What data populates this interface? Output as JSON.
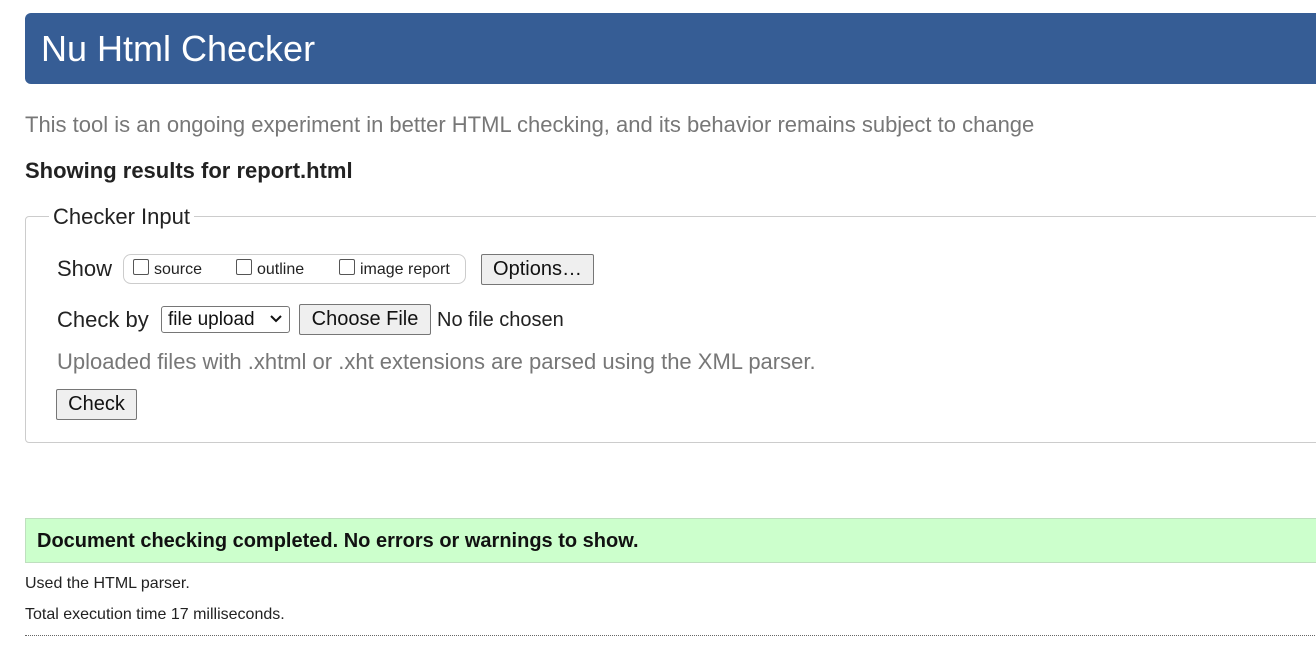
{
  "header": {
    "title": "Nu Html Checker",
    "accent_color": "#365d95"
  },
  "intro": {
    "text": "This tool is an ongoing experiment in better HTML checking, and its behavior remains subject to change"
  },
  "results": {
    "heading": "Showing results for report.html"
  },
  "checker_input": {
    "legend": "Checker Input",
    "show_label": "Show",
    "show_options": [
      {
        "label": "source",
        "checked": false
      },
      {
        "label": "outline",
        "checked": false
      },
      {
        "label": "image report",
        "checked": false
      }
    ],
    "options_button": "Options…",
    "check_by_label": "Check by",
    "check_by_selected": "file upload",
    "choose_file_button": "Choose File",
    "file_status": "No file chosen",
    "hint": "Uploaded files with .xhtml or .xht extensions are parsed using the XML parser.",
    "check_button": "Check"
  },
  "status": {
    "message": "Document checking completed. No errors or warnings to show.",
    "success_color": "#ccffcc",
    "parser_note": "Used the HTML parser.",
    "execution_time": "Total execution time 17 milliseconds."
  }
}
